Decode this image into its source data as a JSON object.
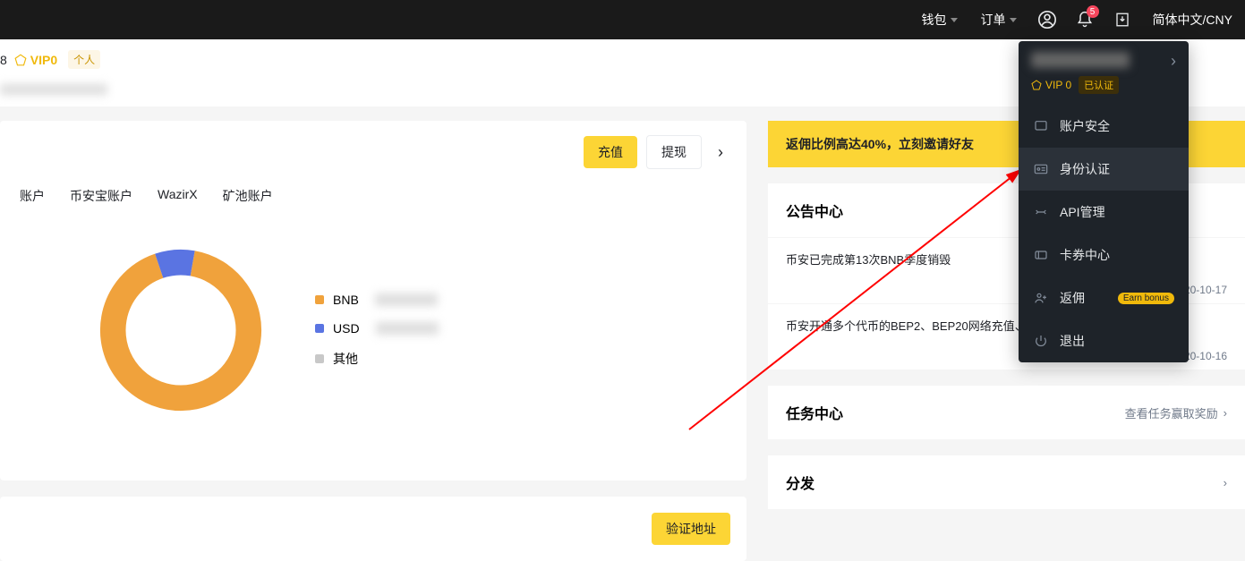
{
  "topbar": {
    "wallet": "钱包",
    "orders": "订单",
    "lang": "简体中文/CNY",
    "notif_count": "5"
  },
  "user_strip": {
    "id_fragment": "8",
    "vip": "VIP0",
    "personal": "个人"
  },
  "actions": {
    "deposit": "充值",
    "withdraw": "提现",
    "verify_address": "验证地址"
  },
  "tabs": [
    "账户",
    "币安宝账户",
    "WazirX",
    "矿池账户"
  ],
  "chart_data": {
    "type": "pie",
    "title": "",
    "series": [
      {
        "name": "BNB",
        "value": 92,
        "color": "#f0a23c"
      },
      {
        "name": "USD",
        "value": 8,
        "color": "#5a74e2"
      },
      {
        "name": "其他",
        "value": 0,
        "color": "#c8c8c8"
      }
    ]
  },
  "banner": "返佣比例高达40%，立刻邀请好友",
  "announcements": {
    "title": "公告中心",
    "items": [
      {
        "text": "币安已完成第13次BNB季度销毁",
        "date": "2020-10-17"
      },
      {
        "text": "币安开通多个代币的BEP2、BEP20网络充值、提现",
        "date": "2020-10-16"
      }
    ]
  },
  "tasks": {
    "title": "任务中心",
    "link": "查看任务赢取奖励"
  },
  "distribute": {
    "title": "分发"
  },
  "dropdown": {
    "vip": "VIP 0",
    "verified": "已认证",
    "items": {
      "security": "账户安全",
      "identity": "身份认证",
      "api": "API管理",
      "coupon": "卡券中心",
      "referral": "返佣",
      "earn_badge": "Earn bonus",
      "logout": "退出"
    }
  }
}
